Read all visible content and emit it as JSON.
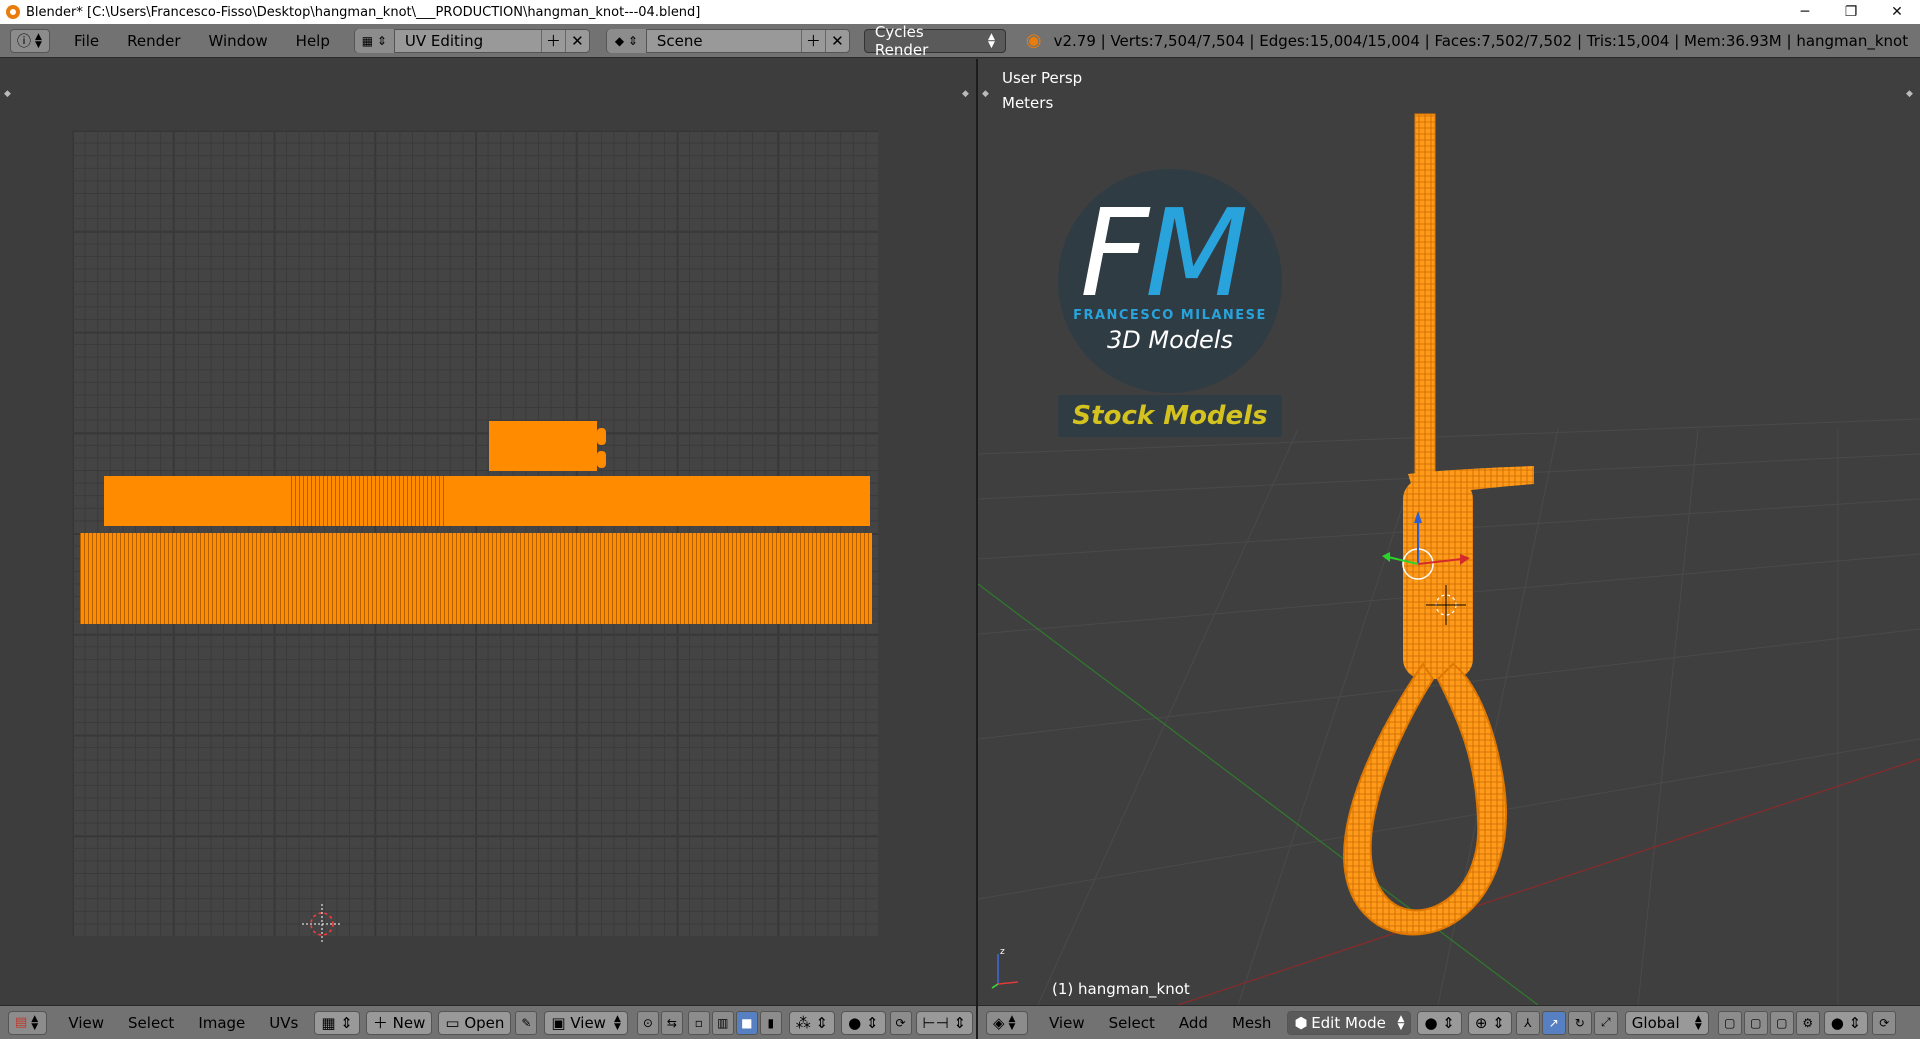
{
  "window": {
    "title": "Blender* [C:\\Users\\Francesco-Fisso\\Desktop\\hangman_knot\\___PRODUCTION\\hangman_knot---04.blend]",
    "minimize": "─",
    "maximize": "❐",
    "close": "✕"
  },
  "info_header": {
    "menus": [
      "File",
      "Render",
      "Window",
      "Help"
    ],
    "screen_layout": "UV Editing",
    "scene": "Scene",
    "render_engine": "Cycles Render",
    "stats": "v2.79 | Verts:7,504/7,504 | Edges:15,004/15,004 | Faces:7,502/7,502 | Tris:15,004 | Mem:36.93M | hangman_knot"
  },
  "uv_editor": {
    "header": {
      "menus": [
        "View",
        "Select",
        "Image",
        "UVs"
      ],
      "new_label": "New",
      "open_label": "Open",
      "view_label": "View"
    }
  },
  "viewport": {
    "overlay_view": "User Persp",
    "overlay_units": "Meters",
    "object_label": "(1) hangman_knot",
    "watermark": {
      "letters_f": "F",
      "letters_m": "M",
      "name": "FRANCESCO MILANESE",
      "subtitle": "3D Models",
      "badge": "Stock Models"
    },
    "header": {
      "menus": [
        "View",
        "Select",
        "Add",
        "Mesh"
      ],
      "mode": "Edit Mode",
      "orientation": "Global"
    }
  },
  "colors": {
    "mesh": "#ff8c00",
    "logo_blue": "#29a3dc",
    "logo_badge_text": "#d4c21f",
    "header_bg": "#727272",
    "editor_bg": "#3d3d3d"
  }
}
